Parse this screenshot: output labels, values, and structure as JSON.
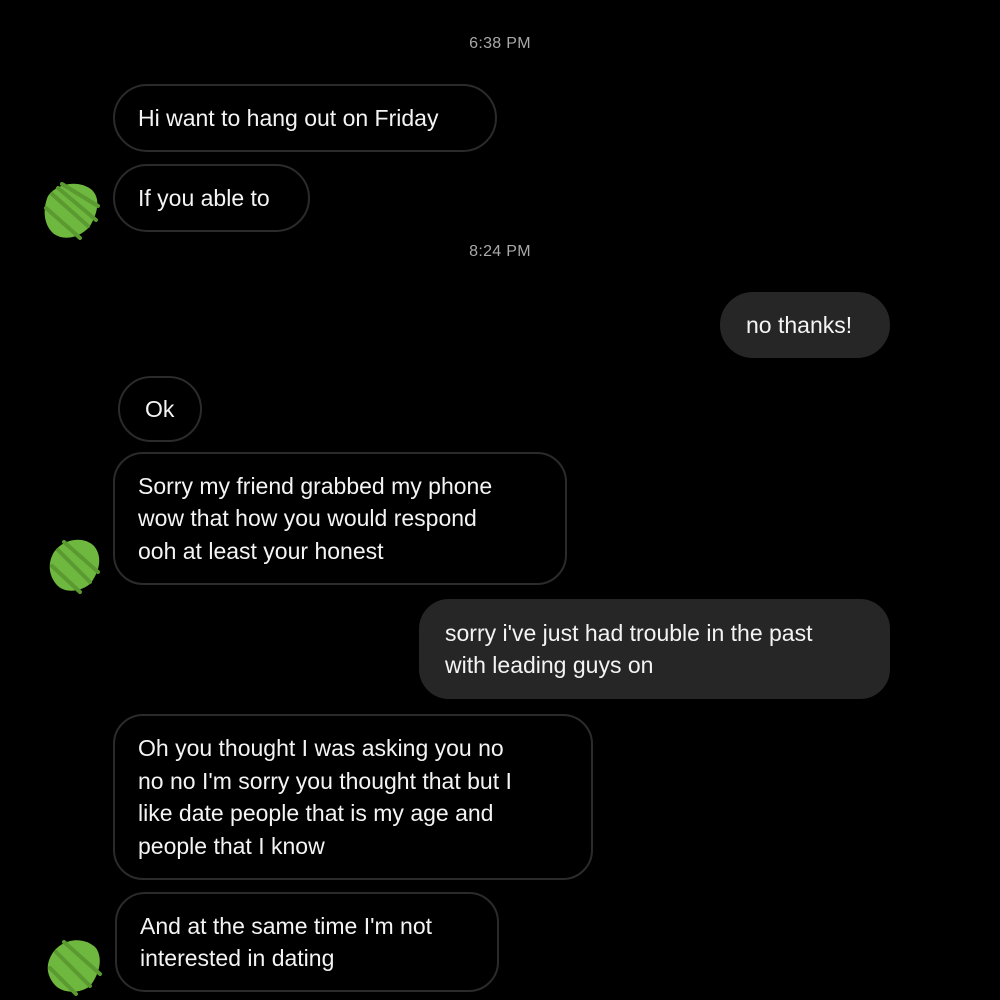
{
  "conversation": {
    "timestamps": [
      "6:38 PM",
      "8:24 PM"
    ],
    "messages": [
      {
        "sender": "them",
        "text": "Hi want to hang out on Friday"
      },
      {
        "sender": "them",
        "text": "If you able to"
      },
      {
        "sender": "me",
        "text": "no thanks!"
      },
      {
        "sender": "them",
        "text": "Ok"
      },
      {
        "sender": "them",
        "text": "Sorry my friend grabbed my phone\nwow that how you would respond\nooh at least your honest"
      },
      {
        "sender": "me",
        "text": "sorry i've just had trouble in the past\nwith leading guys on"
      },
      {
        "sender": "them",
        "text": "Oh you thought I was asking you no\nno no I'm sorry you thought that but I\nlike date people that is my age and\npeople that I know"
      },
      {
        "sender": "them",
        "text": "And at the same time I'm not\ninterested in dating"
      }
    ]
  },
  "avatar": {
    "icon": "redacted-avatar-icon",
    "color": "#6fb83f"
  },
  "colors": {
    "background": "#000000",
    "outgoing_bubble": "#262626",
    "incoming_border": "#2b2b2b",
    "timestamp": "#a9a9a9"
  }
}
